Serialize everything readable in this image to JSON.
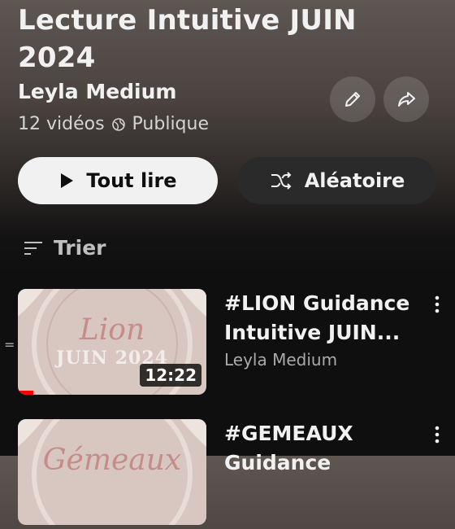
{
  "playlist": {
    "title": "Lecture Intuitive JUIN 2024",
    "channel": "Leyla Medium",
    "video_count": "12 vidéos",
    "visibility": "Publique"
  },
  "actions": {
    "play_all": "Tout lire",
    "shuffle": "Aléatoire"
  },
  "sort": {
    "label": "Trier"
  },
  "videos": [
    {
      "title": "#LION Guidance Intuitive JUIN...",
      "channel": "Leyla Medium",
      "duration": "12:22",
      "thumb_line1": "Lion",
      "thumb_line2": "JUIN 2024",
      "progress": 0.08
    },
    {
      "title": "#GEMEAUX Guidance",
      "channel": "",
      "duration": "",
      "thumb_line1": "Gémeaux",
      "thumb_line2": ""
    }
  ],
  "colors": {
    "progress": "#ff0000",
    "thumb_bg": "#d8c6c0"
  }
}
